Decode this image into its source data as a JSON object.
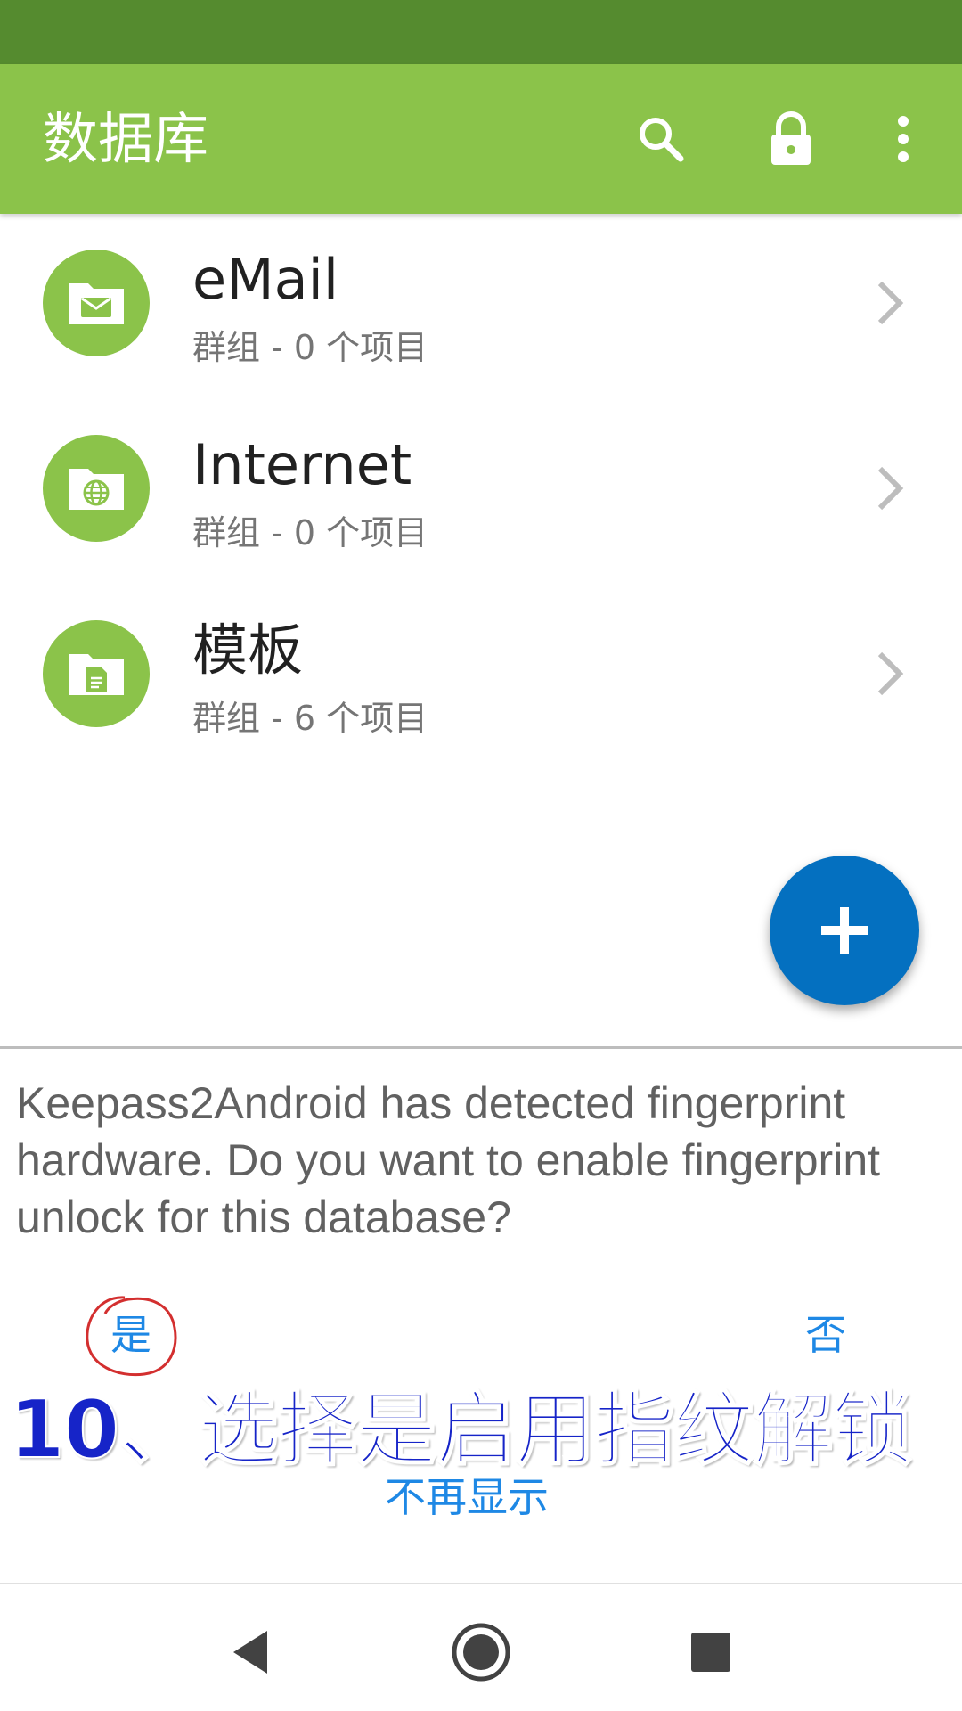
{
  "appbar": {
    "title": "数据库",
    "icons": [
      "search-icon",
      "lock-icon",
      "more-vert-icon"
    ],
    "color": "#8bc34a"
  },
  "status_bar": {
    "color": "#558b2f"
  },
  "groups": [
    {
      "title": "eMail",
      "subtitle": "群组 - 0 个项目",
      "icon": "email-folder-icon"
    },
    {
      "title": "Internet",
      "subtitle": "群组 - 0 个项目",
      "icon": "globe-folder-icon"
    },
    {
      "title": "模板",
      "subtitle": "群组 - 6 个项目",
      "icon": "document-folder-icon"
    }
  ],
  "fab": {
    "icon": "plus-icon",
    "color": "#0470c0"
  },
  "fingerprint_prompt": {
    "message": "Keepass2Android has detected fingerprint hardware. Do you want to enable fingerprint unlock for this database?",
    "yes_label": "是",
    "no_label": "否",
    "dont_show_label": "不再显示"
  },
  "annotation": {
    "caption": "10、选择是启用指纹解锁",
    "caption_color": "#1624c8",
    "highlight_color": "#d32f2f"
  },
  "navbar": {
    "icons": [
      "back-icon",
      "home-icon",
      "recents-icon"
    ]
  }
}
